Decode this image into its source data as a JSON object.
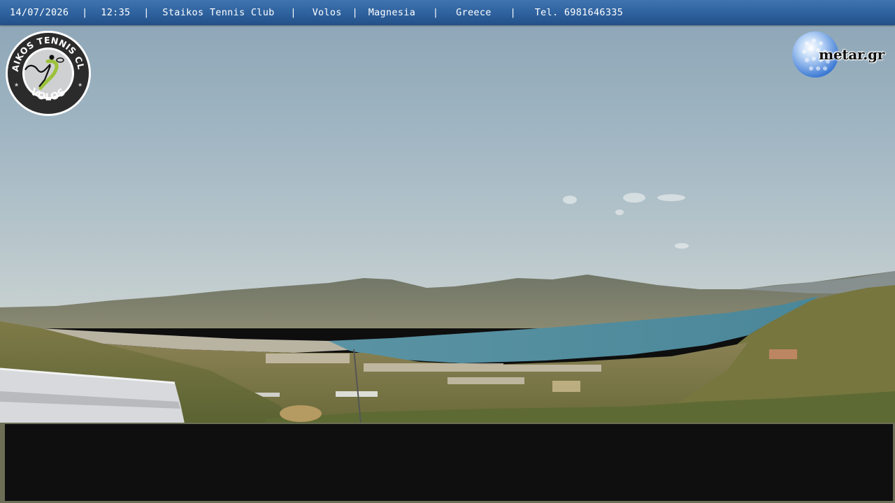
{
  "overlay": {
    "date": "14/07/2026",
    "time": "12:35",
    "club": "Staikos Tennis Club",
    "city": "Volos",
    "region": "Magnesia",
    "country": "Greece",
    "phone": "Tel. 6981646335",
    "separator": "|"
  },
  "club_logo": {
    "text_top": "STAIKOS TENNIS CLUB",
    "text_bottom": "VOLOS",
    "icon": "tennis-player-icon"
  },
  "brand": {
    "text": "metar.gr",
    "icon": "golf-ball-globe-icon"
  },
  "colors": {
    "bar": "#2c5f9c",
    "sea": "#4d8ea0",
    "sky_top": "#8ba4b6",
    "sky_horizon": "#c9d2d2"
  }
}
